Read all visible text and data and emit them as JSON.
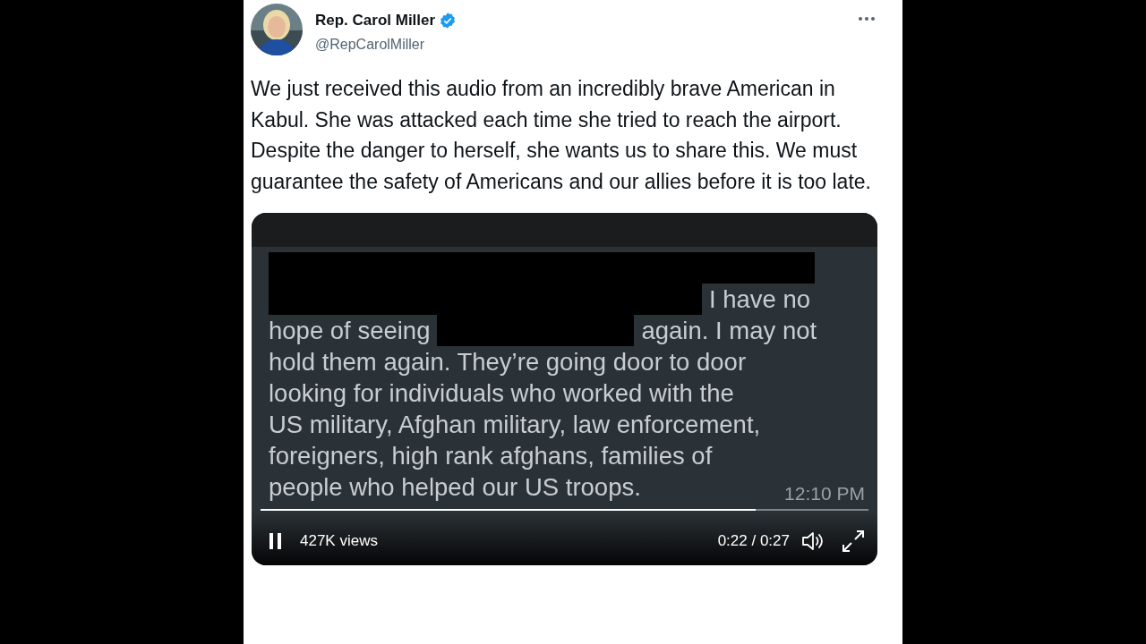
{
  "tweet": {
    "author_name": "Rep. Carol Miller",
    "verified": true,
    "handle": "@RepCarolMiller",
    "text": "We just received this audio from an incredibly brave American in Kabul. She was attacked each time she tried to reach the airport. Despite the danger to herself, she wants us to share this. We must guarantee the safety of Americans and our allies before it is too late."
  },
  "video": {
    "message_lines": [
      [
        {
          "kind": "redaction"
        }
      ],
      [
        {
          "kind": "redaction"
        },
        {
          "kind": "text",
          "text": "I have no"
        }
      ],
      [
        {
          "kind": "text",
          "text": "hope of seeing"
        },
        {
          "kind": "redaction"
        },
        {
          "kind": "text",
          "text": "again. I may not"
        }
      ],
      [
        {
          "kind": "text",
          "text": "hold them again. They’re going door to door"
        }
      ],
      [
        {
          "kind": "text",
          "text": "looking for individuals who worked with the"
        }
      ],
      [
        {
          "kind": "text",
          "text": "US military, Afghan military, law enforcement,"
        }
      ],
      [
        {
          "kind": "text",
          "text": "foreigners, high rank afghans, families of"
        }
      ],
      [
        {
          "kind": "text",
          "text": "people who helped our US troops."
        }
      ]
    ],
    "message_time": "12:10 PM",
    "playing": true,
    "level": 0.815,
    "views": "427K views",
    "time": "0:22 / 0:27"
  }
}
